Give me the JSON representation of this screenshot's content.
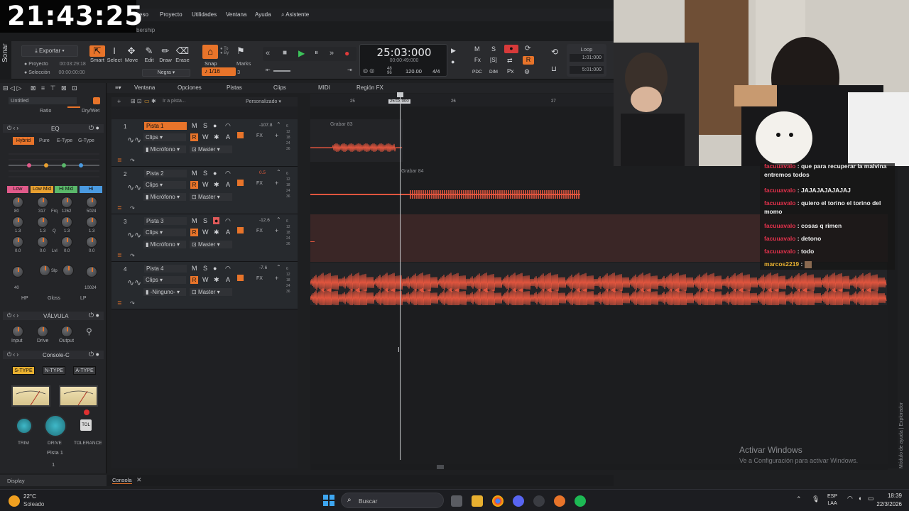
{
  "overlay_clock": "21:43:25",
  "menu": [
    "ceso",
    "Proyecto",
    "Utilidades",
    "Ventana",
    "Ayuda",
    "Asistente"
  ],
  "subbar_text": "bership",
  "sonar_label": "Sonar",
  "export": {
    "label": "Exportar",
    "project_label": "Proyecto",
    "project_time": "00:03:29:18",
    "selection_label": "Selección",
    "selection_time": "00:00:00:00"
  },
  "tools": [
    "Smart",
    "Select",
    "Move",
    "Edit",
    "Draw",
    "Erase"
  ],
  "tool_color": "Negra",
  "snap": {
    "label": "Snap",
    "value": "1/16",
    "marks": "Marks",
    "num": "3"
  },
  "transport": {
    "time": "25:03:000",
    "sub": "00:00:49:000",
    "sig_top": "48",
    "sig_bot": "96",
    "tempo": "120.00",
    "meter": "4/4"
  },
  "mix_buttons": [
    "M",
    "S",
    "R"
  ],
  "mix_labels": [
    "PDC",
    "DIM",
    "Px"
  ],
  "loop": {
    "label": "Loop",
    "start": "1:01:000",
    "end": "5:01:000"
  },
  "secbar": [
    "Ventana",
    "Opciones",
    "Pistas",
    "Clips",
    "MIDI",
    "Región FX"
  ],
  "goto_placeholder": "Ir a pista...",
  "preset": "Personalizado",
  "ruler": [
    "25",
    "26",
    "27"
  ],
  "ruler_marker": "25:03:000",
  "left_panel": {
    "title": "Untitled",
    "ratio": "Ratio",
    "drywet": "Dry/Wet",
    "eq_label": "EQ",
    "eq_modes": [
      "Hybrid",
      "Pure",
      "E-Type",
      "G-Type"
    ],
    "bands": [
      "Low",
      "Low Mid",
      "Hi Mid",
      "Hi"
    ],
    "freq_vals": [
      "80",
      "317",
      "1262",
      "5024"
    ],
    "freq_label": "Frq",
    "q_vals": [
      "1.3",
      "1.3",
      "1.3",
      "1.3"
    ],
    "q_label": "Q",
    "lvl_vals": [
      "0.0",
      "0.0",
      "0.0",
      "0.0"
    ],
    "lvl_label": "Lvl",
    "hp_val": "40",
    "lp_val": "10024",
    "slp": "Slp",
    "filters": [
      "HP",
      "Gloss",
      "LP"
    ],
    "valve_label": "VÁLVULA",
    "valve_knobs": [
      "Input",
      "Drive",
      "Output"
    ],
    "console_label": "Console-C",
    "console_types": [
      "S-TYPE",
      "N-TYPE",
      "A-TYPE"
    ],
    "console_knobs": [
      "TRIM",
      "DRIVE",
      "TOLERANCE"
    ],
    "tol": "TOL",
    "track_name": "Pista 1",
    "track_num": "1"
  },
  "tracks": [
    {
      "num": "1",
      "name": "Pista 1",
      "vol": "-107.8",
      "input": "Micrófono",
      "clips": "Clips",
      "out": "Master",
      "clip": "Grabar 83",
      "active": true,
      "armed": false
    },
    {
      "num": "2",
      "name": "Pista 2",
      "vol": "0.5",
      "input": "Micrófono",
      "clips": "Clips",
      "out": "Master",
      "clip": "Grabar 84",
      "active": false,
      "armed": false
    },
    {
      "num": "3",
      "name": "Pista 3",
      "vol": "-12.6",
      "input": "Micrófono",
      "clips": "Clips",
      "out": "Master",
      "clip": "",
      "active": false,
      "armed": true
    },
    {
      "num": "4",
      "name": "Pista 4",
      "vol": "-7.6",
      "input": "-Ninguno-",
      "clips": "Clips",
      "out": "Master",
      "clip": "",
      "active": false,
      "armed": false
    }
  ],
  "track_btn_labels": {
    "m": "M",
    "s": "S",
    "r": "R",
    "w": "W",
    "a": "A",
    "fx": "FX",
    "db": "dB"
  },
  "chat": [
    {
      "user": "facuuavalo",
      "msg": "que para recuperar la malvina entremos todos"
    },
    {
      "user": "facuuavalo",
      "msg": "JAJAJAJAJAJAJ"
    },
    {
      "user": "facuuavalo",
      "msg": "quiero el torino el torino del momo"
    },
    {
      "user": "facuuavalo",
      "msg": "cosas q rimen"
    },
    {
      "user": "facuuavalo",
      "msg": "detono"
    },
    {
      "user": "facuuavalo",
      "msg": "todo"
    },
    {
      "user": "marcos2219",
      "msg": ""
    }
  ],
  "activate": {
    "title": "Activar Windows",
    "sub": "Ve a Configuración para activar Windows."
  },
  "side_vertical": "Módulo de ayuda | Explorador",
  "console_tab": "Consola",
  "display": "Display",
  "taskbar": {
    "temp": "22°C",
    "weather": "Soleado",
    "search": "Buscar",
    "lang1": "ESP",
    "lang2": "LAA",
    "time": "18:39",
    "date": "22/3/2026"
  },
  "colors": {
    "accent": "#e8742a",
    "wave": "#e0553e",
    "chat_user": "#e0314b"
  }
}
